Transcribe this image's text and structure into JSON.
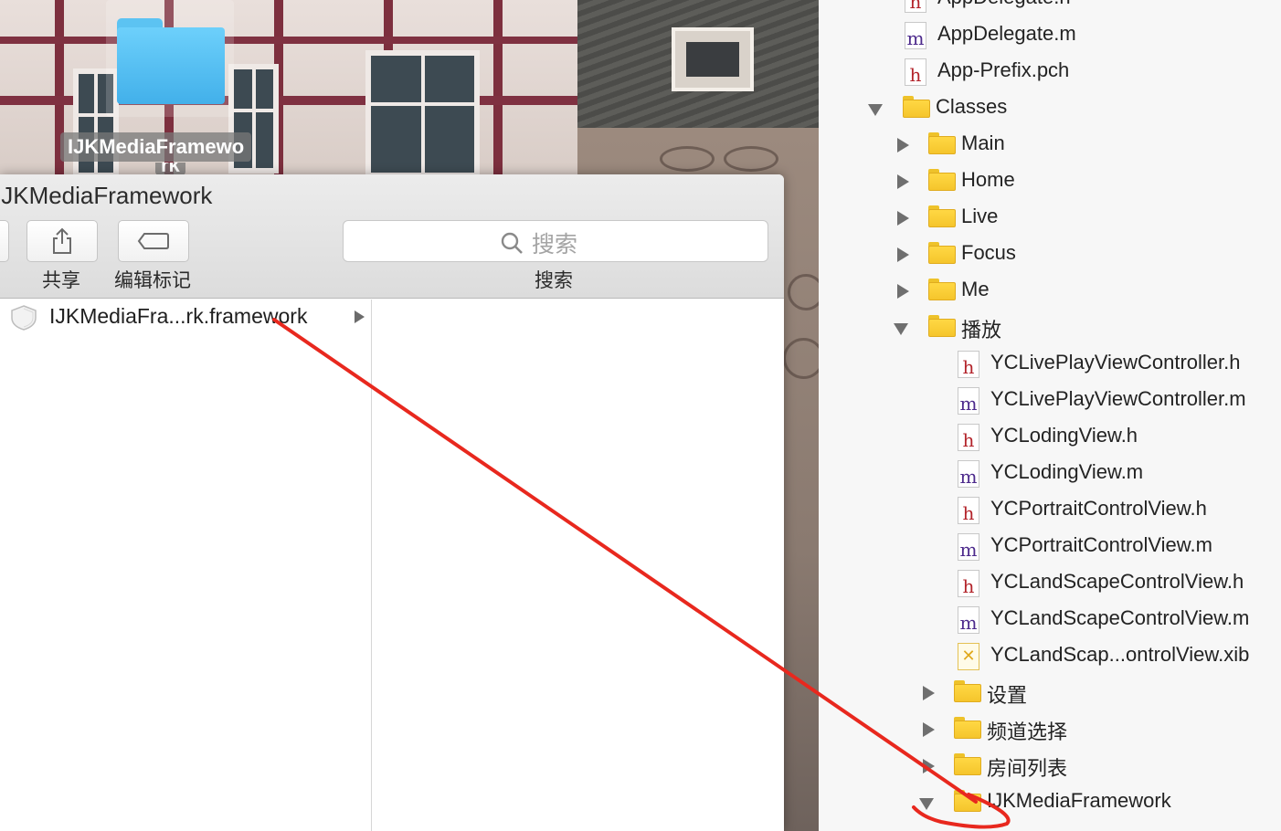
{
  "desktop": {
    "folder_label_line1": "IJKMediaFramewo",
    "folder_label_line2": "rk"
  },
  "finder": {
    "title": "IJKMediaFramework",
    "toolbar": {
      "share_label": "共享",
      "edit_tags_label": "编辑标记",
      "search_label": "搜索",
      "search_placeholder": "搜索"
    },
    "files": [
      {
        "name": "IJKMediaFra...rk.framework",
        "icon": "framework-icon",
        "has_children": true
      }
    ]
  },
  "navigator": {
    "items": [
      {
        "label": "AppDelegate.h",
        "kind": "h",
        "depth": 1
      },
      {
        "label": "AppDelegate.m",
        "kind": "m",
        "depth": 1
      },
      {
        "label": "App-Prefix.pch",
        "kind": "h",
        "depth": 1
      },
      {
        "label": "Classes",
        "kind": "folder",
        "depth": 1,
        "expanded": true
      },
      {
        "label": "Main",
        "kind": "folder",
        "depth": 2,
        "expanded": false
      },
      {
        "label": "Home",
        "kind": "folder",
        "depth": 2,
        "expanded": false
      },
      {
        "label": "Live",
        "kind": "folder",
        "depth": 2,
        "expanded": false
      },
      {
        "label": "Focus",
        "kind": "folder",
        "depth": 2,
        "expanded": false
      },
      {
        "label": "Me",
        "kind": "folder",
        "depth": 2,
        "expanded": false
      },
      {
        "label": "播放",
        "kind": "folder",
        "depth": 2,
        "expanded": true
      },
      {
        "label": "YCLivePlayViewController.h",
        "kind": "h",
        "depth": 3
      },
      {
        "label": "YCLivePlayViewController.m",
        "kind": "m",
        "depth": 3
      },
      {
        "label": "YCLodingView.h",
        "kind": "h",
        "depth": 3
      },
      {
        "label": "YCLodingView.m",
        "kind": "m",
        "depth": 3
      },
      {
        "label": "YCPortraitControlView.h",
        "kind": "h",
        "depth": 3
      },
      {
        "label": "YCPortraitControlView.m",
        "kind": "m",
        "depth": 3
      },
      {
        "label": "YCLandScapeControlView.h",
        "kind": "h",
        "depth": 3
      },
      {
        "label": "YCLandScapeControlView.m",
        "kind": "m",
        "depth": 3
      },
      {
        "label": "YCLandScap...ontrolView.xib",
        "kind": "xib",
        "depth": 3
      },
      {
        "label": "设置",
        "kind": "folder",
        "depth": 3,
        "expanded": false
      },
      {
        "label": "频道选择",
        "kind": "folder",
        "depth": 3,
        "expanded": false
      },
      {
        "label": "房间列表",
        "kind": "folder",
        "depth": 3,
        "expanded": false
      },
      {
        "label": "IJKMediaFramework",
        "kind": "folder",
        "depth": 3,
        "expanded": true
      }
    ]
  },
  "annotation_color": "#e8281e"
}
